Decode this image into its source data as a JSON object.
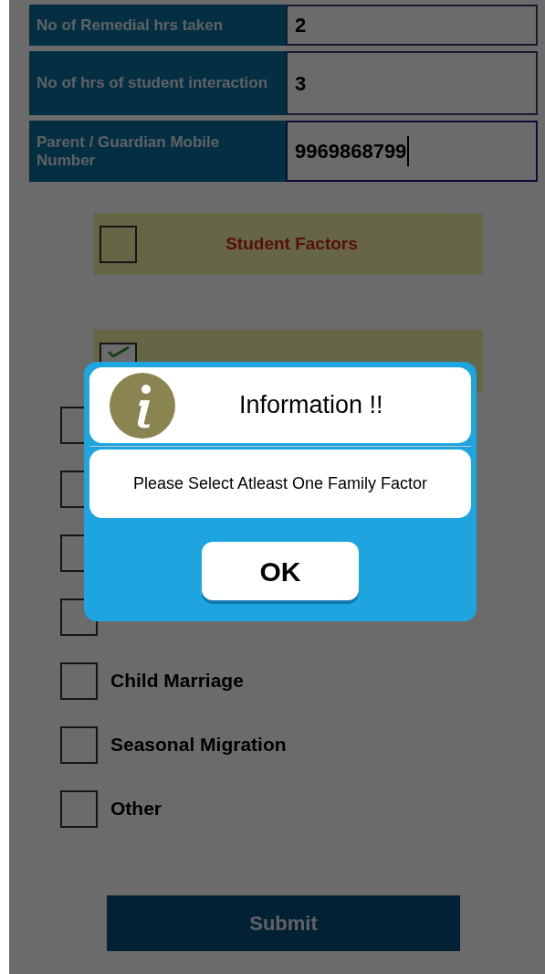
{
  "form_fields": [
    {
      "label": "No of Remedial hrs taken",
      "value": "2",
      "focused": false
    },
    {
      "label": "No of hrs of student interaction",
      "value": "3",
      "focused": false
    },
    {
      "label": "Parent / Guardian Mobile Number",
      "value": "9969868799",
      "focused": true
    }
  ],
  "factor_groups": [
    {
      "label": "Student Factors",
      "checked": false
    },
    {
      "checked": true
    }
  ],
  "family_factor_options": [
    {
      "checked": false
    },
    {
      "checked": false
    },
    {
      "checked": false
    },
    {
      "checked": false
    },
    {
      "label": "Child Marriage",
      "checked": false
    },
    {
      "label": "Seasonal Migration",
      "checked": false
    },
    {
      "label": "Other",
      "checked": false
    }
  ],
  "submit_button": "Submit",
  "dialog": {
    "title": "Information !!",
    "message": "Please Select Atleast One Family Factor",
    "button": "OK"
  }
}
